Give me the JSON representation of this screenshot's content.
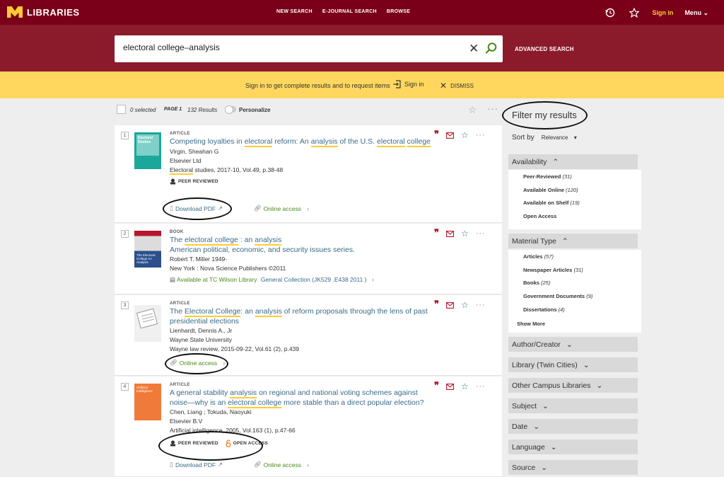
{
  "header": {
    "logo_text": "LIBRARIES",
    "logo_letter": "M",
    "nav": [
      "NEW SEARCH",
      "E-JOURNAL SEARCH",
      "BROWSE"
    ],
    "sign_in": "Sign in",
    "menu": "Menu"
  },
  "search": {
    "query": "electoral college–analysis",
    "advanced": "ADVANCED SEARCH"
  },
  "banner": {
    "message": "Sign in to get complete results and to request items",
    "sign_in": "Sign in",
    "dismiss": "DISMISS"
  },
  "toolbar": {
    "selected": "0 selected",
    "page": "PAGE 1",
    "results": "132 Results",
    "personalize": "Personalize"
  },
  "results": [
    {
      "num": "1",
      "type": "ARTICLE",
      "title_parts": [
        "Competing loyalties in ",
        "electoral",
        " reform: An ",
        "analysis",
        " of the U.S. ",
        "electoral",
        " ",
        "college"
      ],
      "meta": [
        "Virgin, Sheahan G",
        "Elsevier Ltd",
        "studies, 2017-10, Vol.49, p.38-48"
      ],
      "meta_hl": "Electoral",
      "badge": "PEER REVIEWED",
      "link1": "Download PDF",
      "link2": "Online access",
      "thumb_text": "Electoral Studies"
    },
    {
      "num": "2",
      "type": "BOOK",
      "title_parts": [
        "The ",
        "electoral college",
        " : an ",
        "analysis"
      ],
      "subtitle": "American political, economic, and security issues series.",
      "meta": [
        "Robert T. Miller 1949-",
        "New York : Nova Science Publishers ©2011"
      ],
      "avail_prefix": "Available at",
      "avail_library": "TC Wilson Library",
      "avail_location": "General Collection (JK529 .E438 2011 )",
      "thumb_text": "The Electoral College An Analysis"
    },
    {
      "num": "3",
      "type": "ARTICLE",
      "title_parts": [
        "The ",
        "Electoral College",
        ": an ",
        "analysis",
        " of reform proposals through the lens of past presidential elections"
      ],
      "meta": [
        "Lienhardt, Dennis A., Jr",
        "Wayne State University",
        "Wayne law review, 2015-09-22, Vol.61 (2), p.439"
      ],
      "link2": "Online access"
    },
    {
      "num": "4",
      "type": "ARTICLE",
      "title_parts": [
        "A general stability ",
        "analysis",
        " on regional and national voting schemes against noise—why is an ",
        "electoral college",
        " more stable than a direct popular election?"
      ],
      "meta": [
        "Chen, Liang ; Tokuda, Naoyuki",
        "Elsevier B.V",
        "Artificial intelligence, 2005, Vol.163 (1), p.47-66"
      ],
      "badge": "PEER REVIEWED",
      "badge2": "OPEN ACCESS",
      "link1": "Download PDF",
      "link2": "Online access",
      "thumb_text": "Artificial Intelligence"
    }
  ],
  "sidebar": {
    "filter_title": "Filter my results",
    "sort_label": "Sort by",
    "sort_value": "Relevance",
    "availability": {
      "title": "Availability",
      "items": [
        {
          "label": "Peer-Reviewed",
          "count": "(31)"
        },
        {
          "label": "Available Online",
          "count": "(120)"
        },
        {
          "label": "Available on Shelf",
          "count": "(19)"
        },
        {
          "label": "Open Access",
          "count": ""
        }
      ]
    },
    "material": {
      "title": "Material Type",
      "items": [
        {
          "label": "Articles",
          "count": "(57)"
        },
        {
          "label": "Newspaper Articles",
          "count": "(31)"
        },
        {
          "label": "Books",
          "count": "(25)"
        },
        {
          "label": "Government Documents",
          "count": "(9)"
        },
        {
          "label": "Dissertations",
          "count": "(4)"
        }
      ],
      "show_more": "Show More"
    },
    "collapsed": [
      "Author/Creator",
      "Library (Twin Cities)",
      "Other Campus Libraries",
      "Subject",
      "Date",
      "Language",
      "Source"
    ]
  },
  "colors": {
    "maroon": "#7a0019",
    "gold": "#ffcc33",
    "banner": "#ffd75e",
    "link": "#3a6b8a",
    "online": "#4a8a1a"
  }
}
